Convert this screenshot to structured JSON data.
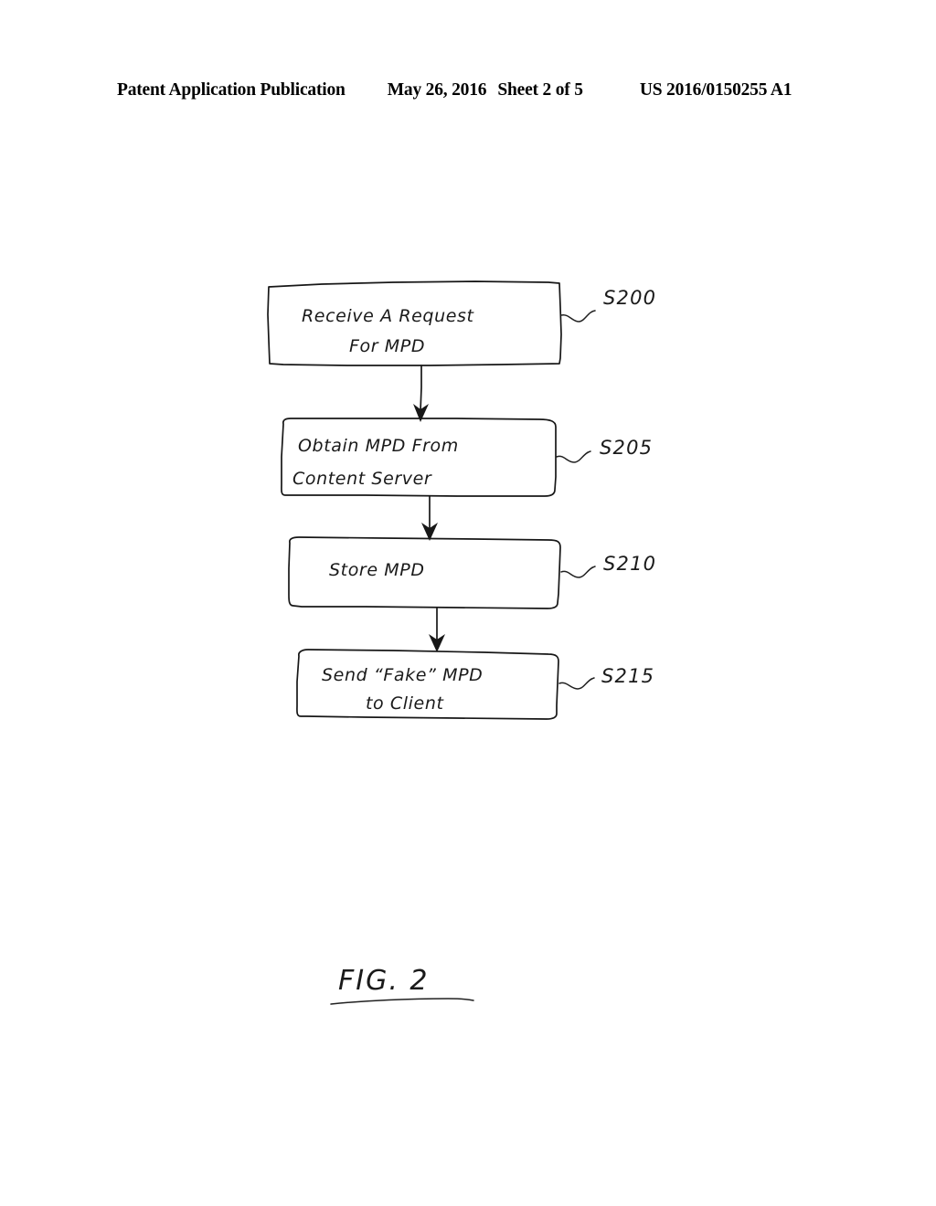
{
  "header": {
    "publication": "Patent Application Publication",
    "date": "May 26, 2016",
    "sheet": "Sheet 2 of 5",
    "patent_number": "US 2016/0150255 A1"
  },
  "figure": {
    "caption": "FIG. 2",
    "type": "flowchart",
    "ink_color": "#171717",
    "background_color": "#ffffff"
  },
  "flowchart": {
    "steps": [
      {
        "ref": "S200",
        "line1": "Receive   A   Request",
        "line2": "For   MPD",
        "text": "Receive A Request For MPD"
      },
      {
        "ref": "S205",
        "line1": "Obtain    MPD   From",
        "line2": "Content     Server",
        "text": "Obtain MPD From Content Server"
      },
      {
        "ref": "S210",
        "line1": "Store    MPD",
        "line2": "",
        "text": "Store MPD"
      },
      {
        "ref": "S215",
        "line1": "Send   “Fake”   MPD",
        "line2": "to    Client",
        "text": "Send “Fake” MPD to Client"
      }
    ],
    "connectors": [
      {
        "from": "S200",
        "to": "S205",
        "kind": "arrow-down"
      },
      {
        "from": "S205",
        "to": "S210",
        "kind": "arrow-down"
      },
      {
        "from": "S210",
        "to": "S215",
        "kind": "arrow-down"
      }
    ]
  }
}
